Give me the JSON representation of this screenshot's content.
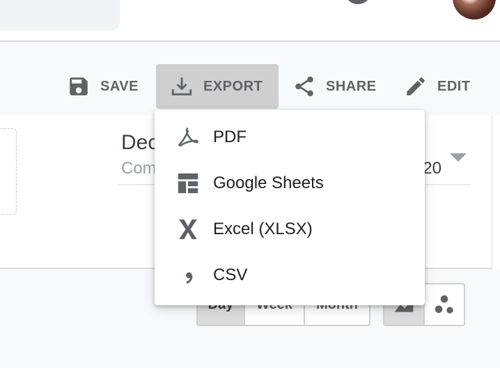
{
  "toolbar": {
    "save_label": "SAVE",
    "export_label": "EXPORT",
    "share_label": "SHARE",
    "edit_label": "EDIT"
  },
  "export_menu": {
    "items": [
      {
        "label": "PDF",
        "icon": "pdf-icon"
      },
      {
        "label": "Google Sheets",
        "icon": "sheets-icon"
      },
      {
        "label": "Excel (XLSX)",
        "icon": "excel-icon"
      },
      {
        "label": "CSV",
        "icon": "csv-icon"
      }
    ]
  },
  "date_field": {
    "title": "Dec",
    "subtitle": "Com",
    "year": "20"
  },
  "range_toggle": {
    "options": [
      "Day",
      "Week",
      "Month"
    ],
    "selected": "Day"
  },
  "colors": {
    "text_primary": "#202124",
    "text_secondary": "#5f6368",
    "active_bg": "#cfcfcf"
  }
}
